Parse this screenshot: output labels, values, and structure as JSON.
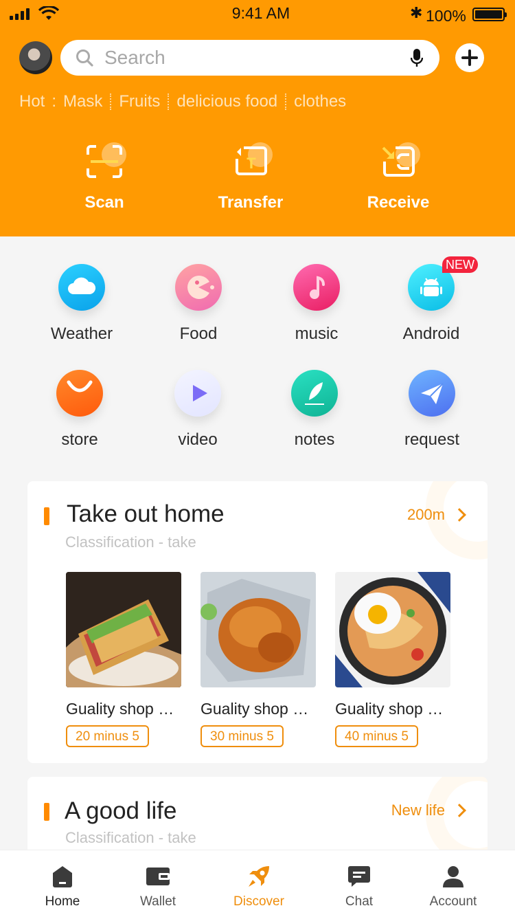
{
  "status_bar": {
    "time": "9:41 AM",
    "battery": "100%"
  },
  "search": {
    "placeholder": "Search"
  },
  "hot": {
    "label": "Hot",
    "tags": [
      "Mask",
      "Fruits",
      "delicious food",
      "clothes"
    ]
  },
  "actions": [
    {
      "label": "Scan",
      "icon": "scan-icon"
    },
    {
      "label": "Transfer",
      "icon": "transfer-icon"
    },
    {
      "label": "Receive",
      "icon": "receive-icon"
    }
  ],
  "grid": [
    {
      "label": "Weather",
      "icon": "cloud-icon",
      "color": "#1ab7f4"
    },
    {
      "label": "Food",
      "icon": "food-icon",
      "color": "#f57fa0"
    },
    {
      "label": "music",
      "icon": "music-note-icon",
      "color": "#f23f7e"
    },
    {
      "label": "Android",
      "icon": "android-icon",
      "color": "#1fc6ef"
    },
    {
      "label": "store",
      "icon": "smile-bag-icon",
      "color": "#ff6a18"
    },
    {
      "label": "video",
      "icon": "play-icon",
      "color": "#e9eaff"
    },
    {
      "label": "notes",
      "icon": "feather-icon",
      "color": "#18c7ac"
    },
    {
      "label": "request",
      "icon": "paper-plane-icon",
      "color": "#5a8ff3"
    }
  ],
  "badge_new": "NEW",
  "card1": {
    "title": "Take out home",
    "subtitle": "Classification - take",
    "more": "200m",
    "items": [
      {
        "name": "Guality shop name",
        "badge": "20 minus 5"
      },
      {
        "name": "Guality shop name",
        "badge": "30 minus 5"
      },
      {
        "name": "Guality shop name",
        "badge": "40 minus 5"
      }
    ]
  },
  "card2": {
    "title": "A good life",
    "subtitle": "Classification - take",
    "more": "New life"
  },
  "tabs": [
    {
      "label": "Home",
      "icon": "home-icon"
    },
    {
      "label": "Wallet",
      "icon": "wallet-icon"
    },
    {
      "label": "Discover",
      "icon": "rocket-icon"
    },
    {
      "label": "Chat",
      "icon": "chat-icon"
    },
    {
      "label": "Account",
      "icon": "account-icon"
    }
  ],
  "colors": {
    "brand": "#ff9a02",
    "accent": "#ef8e0d",
    "badge_red": "#f3243d"
  }
}
